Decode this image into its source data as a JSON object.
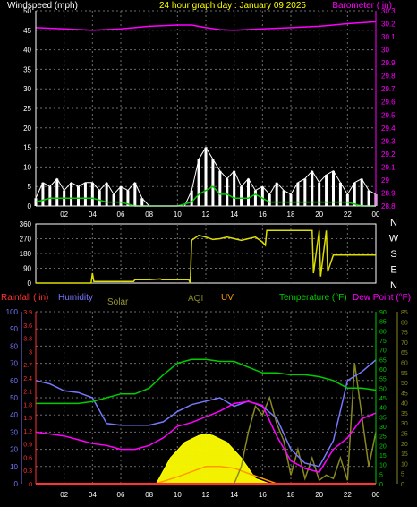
{
  "colors": {
    "background": "#000000",
    "grid": "#6b6b6b",
    "axis_white": "#ffffff",
    "title_yellow": "#ffff00",
    "barometer": "#ff00ff",
    "wind_gust": "#ffffff",
    "wind_avg": "#00cc00",
    "wind_dir": "#dddd00",
    "rainfall": "#ff3333",
    "humidity": "#7777ff",
    "solar": "#ffff00",
    "solar_label": "#999933",
    "aqi": "#888822",
    "uv": "#ff9900",
    "temperature": "#00cc00",
    "dewpoint": "#ff00ff"
  },
  "chart_data": [
    {
      "type": "line",
      "title": "24 hour graph day : January 09 2025",
      "left_axis_label": "Windspeed (mph)",
      "right_axis_label": "Barometer ( in)",
      "x_ticks": [
        "02",
        "04",
        "06",
        "08",
        "10",
        "12",
        "14",
        "16",
        "18",
        "20",
        "22",
        "00"
      ],
      "left_ticks": [
        "0",
        "5",
        "10",
        "15",
        "20",
        "25",
        "30",
        "35",
        "40",
        "45",
        "50"
      ],
      "right_ticks": [
        "28.8",
        "28.9",
        "29",
        "29.1",
        "29.2",
        "29.3",
        "29.4",
        "29.5",
        "29.6",
        "29.7",
        "29.8",
        "29.9",
        "30",
        "30.1",
        "30.2",
        "30.3"
      ],
      "ylim_left": [
        0,
        50
      ],
      "ylim_right": [
        28.8,
        30.3
      ],
      "grid": true,
      "series": {
        "barometer": {
          "x": [
            0,
            2,
            4,
            6,
            8,
            10,
            11,
            12,
            13,
            14,
            16,
            18,
            20,
            22,
            24
          ],
          "y": [
            30.17,
            30.16,
            30.15,
            30.16,
            30.18,
            30.19,
            30.19,
            30.17,
            30.155,
            30.15,
            30.16,
            30.17,
            30.18,
            30.2,
            30.215
          ]
        },
        "gust": {
          "x": [
            0,
            0.5,
            1,
            1.5,
            2,
            2.5,
            3,
            3.5,
            4,
            4.5,
            5,
            5.5,
            6,
            6.5,
            7,
            7.5,
            8,
            8.5,
            9,
            9.5,
            10,
            10.5,
            11,
            11.5,
            12,
            12.5,
            13,
            13.5,
            14,
            14.5,
            15,
            15.5,
            16,
            16.5,
            17,
            17.5,
            18,
            18.5,
            19,
            19.5,
            20,
            20.5,
            21,
            21.5,
            22,
            22.5,
            23,
            23.5,
            24
          ],
          "y": [
            2,
            6,
            5,
            7,
            4,
            6,
            5,
            6,
            6,
            4,
            6,
            3,
            5,
            4,
            6,
            2,
            0,
            0,
            0,
            0,
            0,
            0,
            4,
            12,
            15,
            12,
            9,
            7,
            9,
            5,
            7,
            4,
            5,
            3,
            6,
            4,
            3,
            6,
            7,
            9,
            6,
            8,
            9,
            6,
            3,
            6,
            7,
            4,
            3
          ]
        },
        "average": {
          "x": [
            0,
            1,
            2,
            3,
            4,
            5,
            6,
            6.5,
            7,
            8,
            9,
            10,
            11,
            11.5,
            12,
            12.5,
            13,
            13.5,
            14,
            14.5,
            15,
            15.5,
            16,
            16.5,
            17,
            18,
            19,
            20,
            21,
            22,
            23,
            24
          ],
          "y": [
            1,
            2,
            2,
            2,
            2,
            1,
            1,
            0.5,
            0,
            0,
            0,
            0,
            1,
            3,
            4,
            5,
            3,
            3,
            2,
            2,
            2,
            3,
            2,
            1,
            1,
            1,
            1,
            1,
            1,
            1,
            0,
            0
          ]
        }
      }
    },
    {
      "type": "line",
      "title": "",
      "left_ticks": [
        "0",
        "90",
        "180",
        "270",
        "360"
      ],
      "right_labels": [
        "N",
        "W",
        "S",
        "E",
        "N"
      ],
      "ylim": [
        0,
        360
      ],
      "grid": true,
      "series": {
        "direction": {
          "x": [
            0,
            3.9,
            4,
            4.1,
            5,
            6,
            6.9,
            7,
            8,
            8.8,
            8.9,
            9,
            10.8,
            10.9,
            11,
            11.5,
            12,
            12.5,
            13,
            13.5,
            14,
            14.5,
            15,
            15.5,
            16,
            16.2,
            16.3,
            16.8,
            17,
            17.5,
            18,
            18.5,
            19,
            19.5,
            19.6,
            20,
            20.1,
            20.5,
            20.6,
            21,
            21.5,
            22,
            22.5,
            23,
            24
          ],
          "y": [
            0,
            0,
            60,
            10,
            10,
            10,
            10,
            20,
            20,
            25,
            20,
            20,
            20,
            0,
            260,
            290,
            280,
            265,
            270,
            280,
            270,
            260,
            270,
            280,
            250,
            230,
            320,
            320,
            320,
            320,
            320,
            320,
            320,
            320,
            60,
            320,
            40,
            320,
            70,
            170,
            170,
            170,
            170,
            170,
            170
          ]
        }
      }
    },
    {
      "type": "line",
      "legend": [
        "Rainfall ( in)",
        "Humidity",
        "Solar",
        "AQI",
        "UV",
        "Temperature (°F)",
        "Dew Point (°F)"
      ],
      "x_ticks": [
        "02",
        "04",
        "06",
        "08",
        "10",
        "12",
        "14",
        "16",
        "18",
        "20",
        "22",
        "00"
      ],
      "rain_ticks": [
        "0",
        "0.3",
        "0.6",
        "0.9",
        "1.2",
        "1.5",
        "1.8",
        "2.1",
        "2.4",
        "2.7",
        "3",
        "3.3",
        "3.6",
        "3.9"
      ],
      "humidity_ticks": [
        "0",
        "10",
        "20",
        "30",
        "40",
        "50",
        "60",
        "70",
        "80",
        "90",
        "100"
      ],
      "temp_ticks": [
        "0",
        "5",
        "10",
        "15",
        "20",
        "25",
        "30",
        "35",
        "40",
        "45",
        "50",
        "55",
        "60",
        "65",
        "70",
        "75",
        "80",
        "85",
        "90"
      ],
      "aqi_ticks": [
        "0",
        "5",
        "10",
        "15",
        "20",
        "25",
        "30",
        "35",
        "40",
        "45",
        "50",
        "55",
        "60",
        "65",
        "70",
        "75",
        "80",
        "85"
      ],
      "ylim_temp": [
        0,
        90
      ],
      "ylim_humidity": [
        0,
        100
      ],
      "grid": true,
      "series": {
        "temperature": {
          "x": [
            0,
            1,
            2,
            3,
            4,
            5,
            6,
            7,
            8,
            9,
            10,
            11,
            12,
            13,
            14,
            15,
            16,
            17,
            18,
            19,
            20,
            21,
            22,
            23,
            24
          ],
          "y": [
            42,
            42,
            42,
            42,
            43,
            45,
            47,
            47,
            50,
            57,
            63,
            65,
            65,
            64,
            64,
            61,
            58,
            58,
            57,
            57,
            56,
            54,
            50,
            50,
            49
          ]
        },
        "dewpoint": {
          "x": [
            0,
            1,
            2,
            3,
            4,
            5,
            6,
            7,
            8,
            9,
            10,
            11,
            12,
            13,
            14,
            15,
            16,
            17,
            18,
            19,
            20,
            21,
            22,
            23,
            24
          ],
          "y": [
            27,
            26,
            25,
            23,
            21,
            20,
            18,
            18,
            20,
            24,
            30,
            32,
            35,
            38,
            42,
            43,
            41,
            25,
            12,
            8,
            6,
            18,
            24,
            34,
            37
          ]
        },
        "humidity": {
          "x": [
            0,
            1,
            2,
            3,
            4,
            5,
            6,
            7,
            8,
            9,
            10,
            11,
            12,
            13,
            14,
            15,
            16,
            17,
            18,
            19,
            20,
            21,
            22,
            23,
            24
          ],
          "y": [
            60,
            58,
            54,
            53,
            50,
            35,
            34,
            34,
            34,
            36,
            42,
            46,
            48,
            50,
            45,
            48,
            45,
            38,
            20,
            12,
            10,
            25,
            60,
            65,
            72
          ]
        },
        "solar": {
          "x": [
            0,
            8.5,
            9.5,
            10.5,
            11.5,
            12,
            12.5,
            13.5,
            14.5,
            15.5,
            16.5,
            24
          ],
          "y": [
            0,
            0,
            15,
            24,
            28,
            29,
            28,
            24,
            15,
            3,
            0,
            0
          ]
        },
        "uv": {
          "x": [
            0,
            8.5,
            10,
            11,
            12,
            13,
            14,
            15,
            16,
            17,
            24
          ],
          "y": [
            0,
            0,
            4,
            7,
            10,
            10,
            9,
            6,
            3,
            0,
            0
          ]
        },
        "aqi": {
          "x": [
            0,
            14,
            14.5,
            15,
            15.5,
            16,
            16.5,
            17,
            17.5,
            18,
            18.5,
            19,
            19.5,
            20,
            20.5,
            21,
            21.5,
            22,
            22.5,
            23,
            23.5,
            24
          ],
          "y": [
            0,
            0,
            10,
            30,
            45,
            40,
            50,
            35,
            25,
            5,
            20,
            3,
            15,
            2,
            5,
            3,
            15,
            2,
            70,
            40,
            10,
            30
          ]
        }
      }
    }
  ]
}
